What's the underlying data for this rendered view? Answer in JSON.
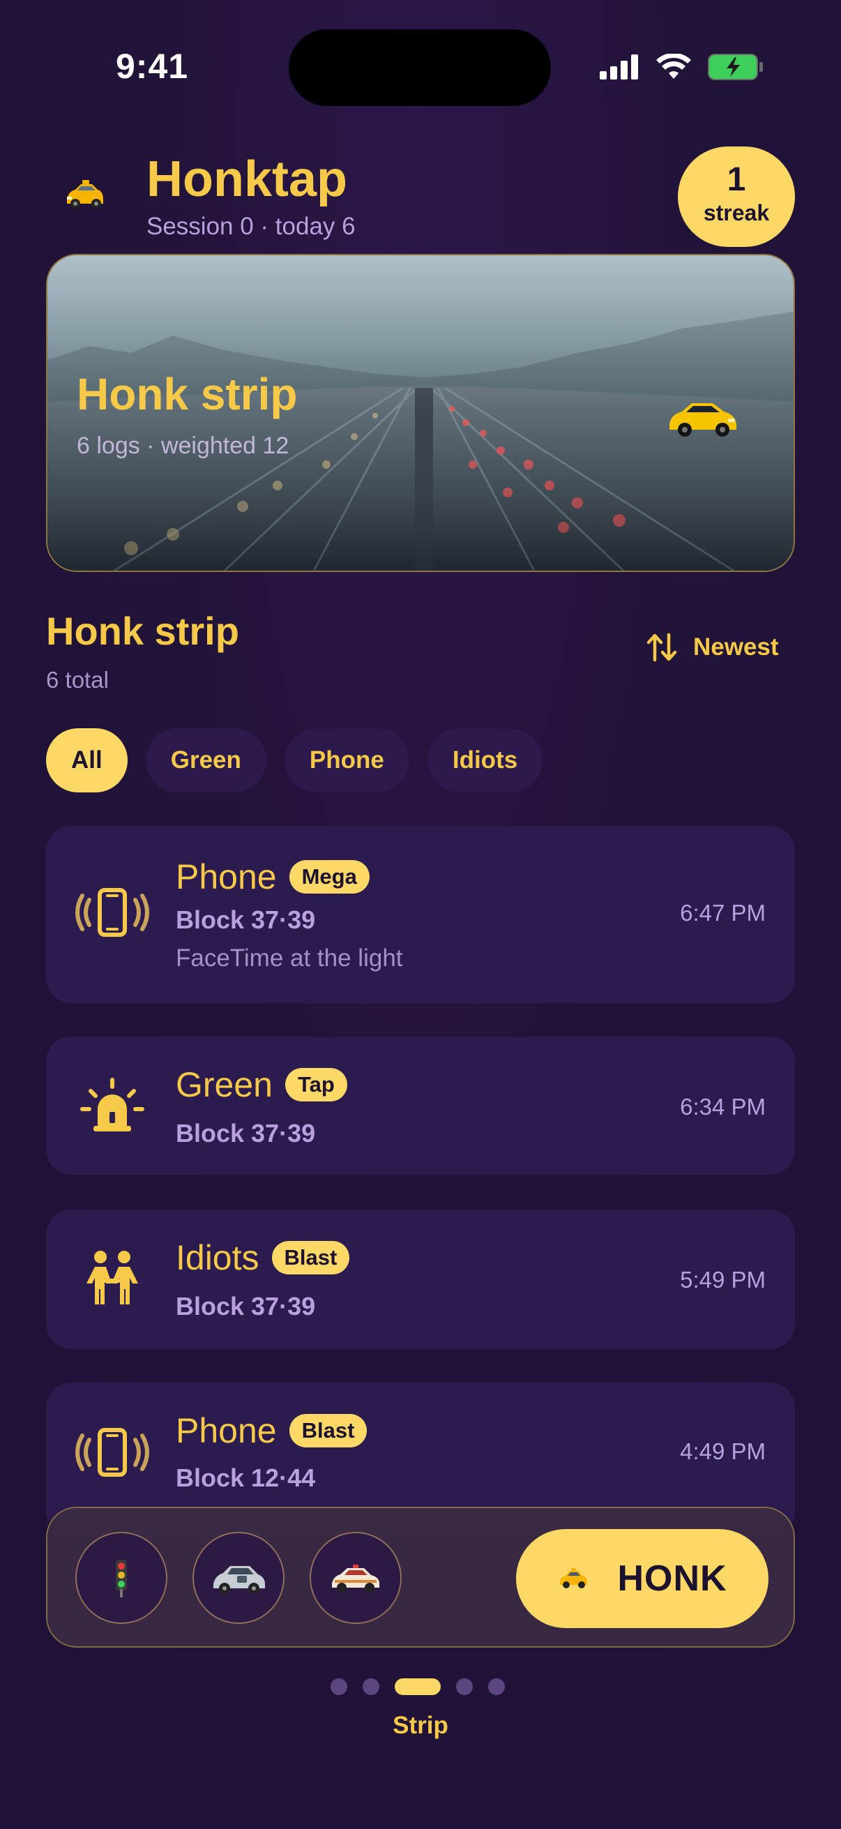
{
  "status_bar": {
    "time": "9:41"
  },
  "header": {
    "title": "Honktap",
    "subtitle": "Session 0 · today 6",
    "streak_value": "1",
    "streak_label": "streak"
  },
  "hero": {
    "title": "Honk strip",
    "subtitle": "6 logs · weighted 12"
  },
  "section": {
    "title": "Honk strip",
    "count": "6 total",
    "sort_label": "Newest"
  },
  "filters": [
    "All",
    "Green",
    "Phone",
    "Idiots"
  ],
  "entries": [
    {
      "icon": "phone-vibrate-icon",
      "title": "Phone",
      "badge": "Mega",
      "block": "Block 37·39",
      "note": "FaceTime at the light",
      "time": "6:47 PM"
    },
    {
      "icon": "alarm-light-icon",
      "title": "Green",
      "badge": "Tap",
      "block": "Block 37·39",
      "note": "",
      "time": "6:34 PM"
    },
    {
      "icon": "people-icon",
      "title": "Idiots",
      "badge": "Blast",
      "block": "Block 37·39",
      "note": "",
      "time": "5:49 PM"
    },
    {
      "icon": "phone-vibrate-icon",
      "title": "Phone",
      "badge": "Blast",
      "block": "Block 12·44",
      "note": "",
      "time": "4:49 PM"
    }
  ],
  "dock": {
    "buttons": [
      "traffic-light-icon",
      "car-icon",
      "police-car-icon"
    ],
    "honk_label": "HONK"
  },
  "pager": {
    "label": "Strip",
    "total": 5,
    "active": 3
  },
  "colors": {
    "accent": "#fcd867",
    "background": "#241440",
    "card": "#2c1b4f",
    "muted": "#b7a2dd"
  }
}
